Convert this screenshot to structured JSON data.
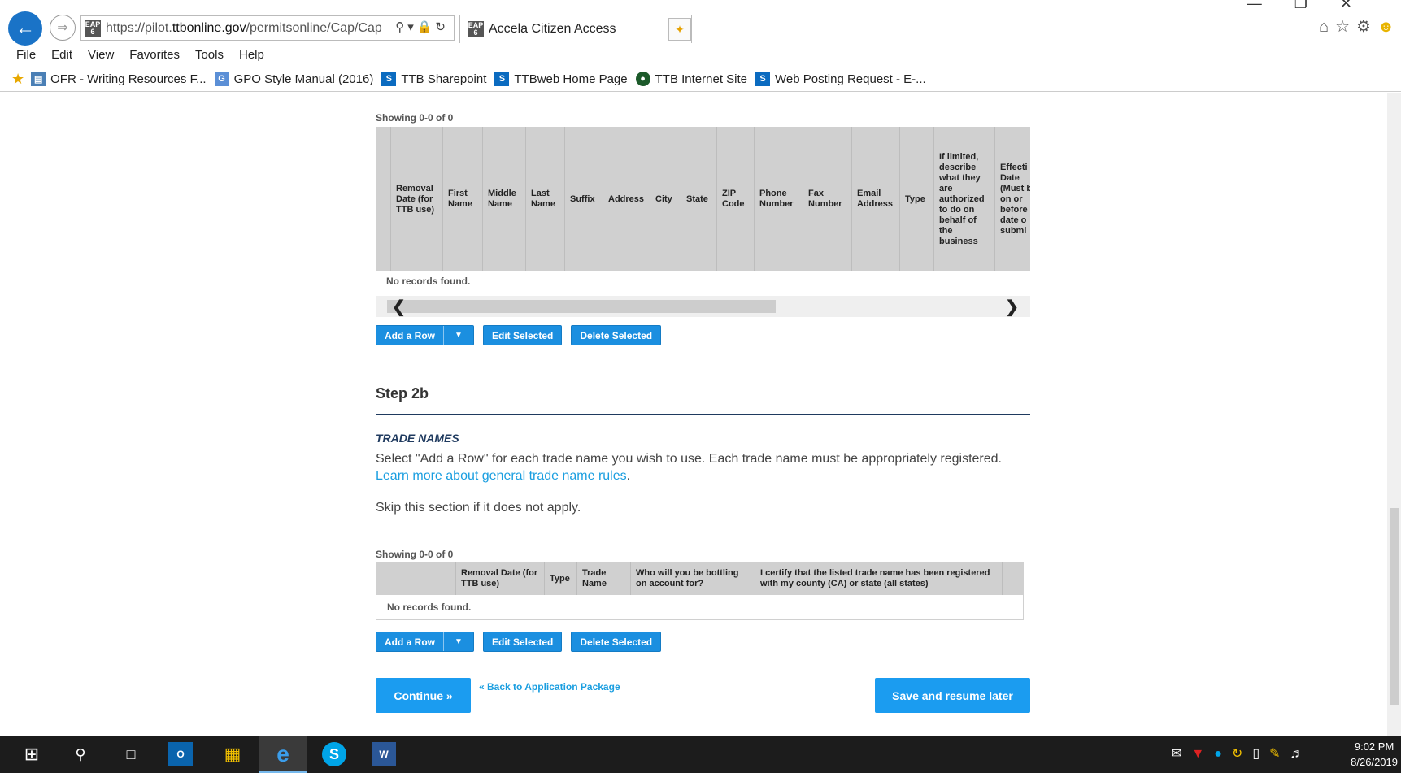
{
  "browser": {
    "url_prefix": "https://pilot.",
    "url_domain": "ttbonline.gov",
    "url_path": "/permitsonline/Cap/Cap",
    "tab_title": "Accela Citizen Access",
    "favicon_text": "EAP 6"
  },
  "menu": [
    "File",
    "Edit",
    "View",
    "Favorites",
    "Tools",
    "Help"
  ],
  "favorites": [
    {
      "label": "OFR - Writing Resources F...",
      "icon": "document-icon",
      "color": "#4a7fb5"
    },
    {
      "label": "GPO Style Manual (2016)",
      "icon": "gpo-icon",
      "color": "#5b8fd6"
    },
    {
      "label": "TTB Sharepoint",
      "icon": "sharepoint-icon",
      "color": "#0b6bc0"
    },
    {
      "label": "TTBweb Home Page",
      "icon": "sharepoint-icon",
      "color": "#0b6bc0"
    },
    {
      "label": "TTB Internet Site",
      "icon": "seal-icon",
      "color": "#1c5a2a"
    },
    {
      "label": "Web Posting Request - E-...",
      "icon": "sharepoint-icon",
      "color": "#0b6bc0"
    }
  ],
  "grid1": {
    "showing": "Showing 0-0 of 0",
    "columns": [
      "Removal Date (for TTB use)",
      "First Name",
      "Middle Name",
      "Last Name",
      "Suffix",
      "Address",
      "City",
      "State",
      "ZIP Code",
      "Phone Number",
      "Fax Number",
      "Email Address",
      "Type",
      "If limited, describe what they are authorized to do on behalf of the business",
      "Effecti Date (Must b on or before date o submi"
    ],
    "empty_text": "No records found.",
    "buttons": {
      "add": "Add a Row",
      "edit": "Edit Selected",
      "delete": "Delete Selected"
    }
  },
  "step": {
    "title": "Step 2b",
    "section": "TRADE NAMES",
    "desc_text": "Select \"Add a Row\" for each trade name you wish to use. Each trade name must be appropriately registered.",
    "desc_link": "Learn more about general trade name rules",
    "desc_end": ".",
    "skip": "Skip this section if it does not apply."
  },
  "grid2": {
    "showing": "Showing 0-0 of 0",
    "columns": [
      "Removal Date (for TTB use)",
      "Type",
      "Trade Name",
      "Who will you be bottling on account for?",
      "I certify that the listed trade name has been registered with my county (CA) or state (all states)"
    ],
    "empty_text": "No records found.",
    "buttons": {
      "add": "Add a Row",
      "edit": "Edit Selected",
      "delete": "Delete Selected"
    }
  },
  "footer": {
    "continue": "Continue »",
    "back": "« Back to Application Package",
    "save": "Save and resume later"
  },
  "clock": {
    "time": "9:02 PM",
    "date": "8/26/2019"
  }
}
